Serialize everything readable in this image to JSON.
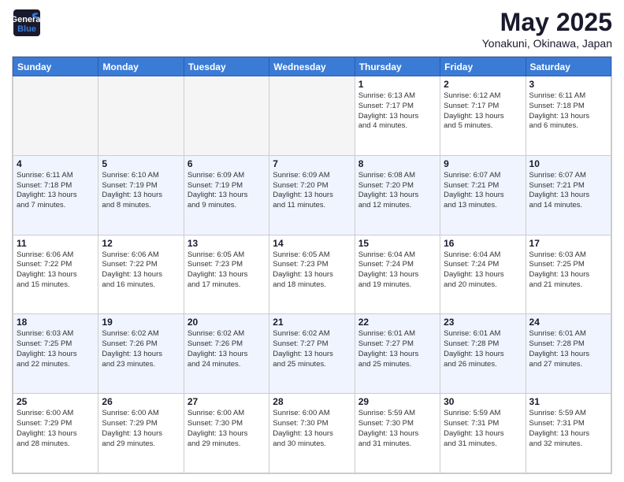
{
  "header": {
    "logo_line1": "General",
    "logo_line2": "Blue",
    "month": "May 2025",
    "location": "Yonakuni, Okinawa, Japan"
  },
  "days_of_week": [
    "Sunday",
    "Monday",
    "Tuesday",
    "Wednesday",
    "Thursday",
    "Friday",
    "Saturday"
  ],
  "weeks": [
    [
      {
        "day": "",
        "empty": true
      },
      {
        "day": "",
        "empty": true
      },
      {
        "day": "",
        "empty": true
      },
      {
        "day": "",
        "empty": true
      },
      {
        "day": "1",
        "info": "Sunrise: 6:13 AM\nSunset: 7:17 PM\nDaylight: 13 hours\nand 4 minutes."
      },
      {
        "day": "2",
        "info": "Sunrise: 6:12 AM\nSunset: 7:17 PM\nDaylight: 13 hours\nand 5 minutes."
      },
      {
        "day": "3",
        "info": "Sunrise: 6:11 AM\nSunset: 7:18 PM\nDaylight: 13 hours\nand 6 minutes."
      }
    ],
    [
      {
        "day": "4",
        "info": "Sunrise: 6:11 AM\nSunset: 7:18 PM\nDaylight: 13 hours\nand 7 minutes."
      },
      {
        "day": "5",
        "info": "Sunrise: 6:10 AM\nSunset: 7:19 PM\nDaylight: 13 hours\nand 8 minutes."
      },
      {
        "day": "6",
        "info": "Sunrise: 6:09 AM\nSunset: 7:19 PM\nDaylight: 13 hours\nand 9 minutes."
      },
      {
        "day": "7",
        "info": "Sunrise: 6:09 AM\nSunset: 7:20 PM\nDaylight: 13 hours\nand 11 minutes."
      },
      {
        "day": "8",
        "info": "Sunrise: 6:08 AM\nSunset: 7:20 PM\nDaylight: 13 hours\nand 12 minutes."
      },
      {
        "day": "9",
        "info": "Sunrise: 6:07 AM\nSunset: 7:21 PM\nDaylight: 13 hours\nand 13 minutes."
      },
      {
        "day": "10",
        "info": "Sunrise: 6:07 AM\nSunset: 7:21 PM\nDaylight: 13 hours\nand 14 minutes."
      }
    ],
    [
      {
        "day": "11",
        "info": "Sunrise: 6:06 AM\nSunset: 7:22 PM\nDaylight: 13 hours\nand 15 minutes."
      },
      {
        "day": "12",
        "info": "Sunrise: 6:06 AM\nSunset: 7:22 PM\nDaylight: 13 hours\nand 16 minutes."
      },
      {
        "day": "13",
        "info": "Sunrise: 6:05 AM\nSunset: 7:23 PM\nDaylight: 13 hours\nand 17 minutes."
      },
      {
        "day": "14",
        "info": "Sunrise: 6:05 AM\nSunset: 7:23 PM\nDaylight: 13 hours\nand 18 minutes."
      },
      {
        "day": "15",
        "info": "Sunrise: 6:04 AM\nSunset: 7:24 PM\nDaylight: 13 hours\nand 19 minutes."
      },
      {
        "day": "16",
        "info": "Sunrise: 6:04 AM\nSunset: 7:24 PM\nDaylight: 13 hours\nand 20 minutes."
      },
      {
        "day": "17",
        "info": "Sunrise: 6:03 AM\nSunset: 7:25 PM\nDaylight: 13 hours\nand 21 minutes."
      }
    ],
    [
      {
        "day": "18",
        "info": "Sunrise: 6:03 AM\nSunset: 7:25 PM\nDaylight: 13 hours\nand 22 minutes."
      },
      {
        "day": "19",
        "info": "Sunrise: 6:02 AM\nSunset: 7:26 PM\nDaylight: 13 hours\nand 23 minutes."
      },
      {
        "day": "20",
        "info": "Sunrise: 6:02 AM\nSunset: 7:26 PM\nDaylight: 13 hours\nand 24 minutes."
      },
      {
        "day": "21",
        "info": "Sunrise: 6:02 AM\nSunset: 7:27 PM\nDaylight: 13 hours\nand 25 minutes."
      },
      {
        "day": "22",
        "info": "Sunrise: 6:01 AM\nSunset: 7:27 PM\nDaylight: 13 hours\nand 25 minutes."
      },
      {
        "day": "23",
        "info": "Sunrise: 6:01 AM\nSunset: 7:28 PM\nDaylight: 13 hours\nand 26 minutes."
      },
      {
        "day": "24",
        "info": "Sunrise: 6:01 AM\nSunset: 7:28 PM\nDaylight: 13 hours\nand 27 minutes."
      }
    ],
    [
      {
        "day": "25",
        "info": "Sunrise: 6:00 AM\nSunset: 7:29 PM\nDaylight: 13 hours\nand 28 minutes."
      },
      {
        "day": "26",
        "info": "Sunrise: 6:00 AM\nSunset: 7:29 PM\nDaylight: 13 hours\nand 29 minutes."
      },
      {
        "day": "27",
        "info": "Sunrise: 6:00 AM\nSunset: 7:30 PM\nDaylight: 13 hours\nand 29 minutes."
      },
      {
        "day": "28",
        "info": "Sunrise: 6:00 AM\nSunset: 7:30 PM\nDaylight: 13 hours\nand 30 minutes."
      },
      {
        "day": "29",
        "info": "Sunrise: 5:59 AM\nSunset: 7:30 PM\nDaylight: 13 hours\nand 31 minutes."
      },
      {
        "day": "30",
        "info": "Sunrise: 5:59 AM\nSunset: 7:31 PM\nDaylight: 13 hours\nand 31 minutes."
      },
      {
        "day": "31",
        "info": "Sunrise: 5:59 AM\nSunset: 7:31 PM\nDaylight: 13 hours\nand 32 minutes."
      }
    ]
  ]
}
